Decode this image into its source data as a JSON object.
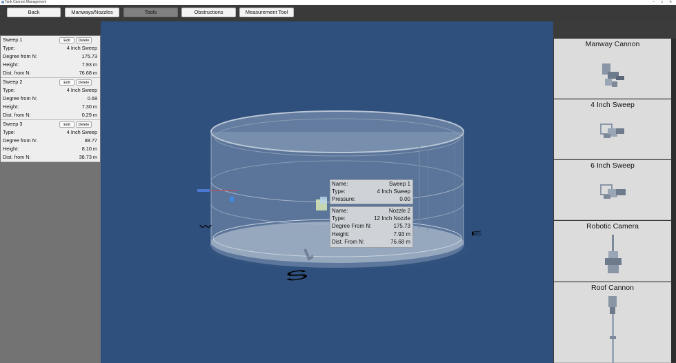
{
  "window": {
    "title": "Tank Cannon Management",
    "controls": [
      "–",
      "□",
      "✕"
    ]
  },
  "toolbar": {
    "buttons": [
      {
        "label": "Back",
        "active": false
      },
      {
        "label": "Manways/Nozzles",
        "active": false
      },
      {
        "label": "Tools",
        "active": true
      },
      {
        "label": "Obstructions",
        "active": false
      },
      {
        "label": "Measurement Tool",
        "active": false
      }
    ]
  },
  "left_panel": {
    "edit_label": "Edit",
    "delete_label": "Delete",
    "sweeps": [
      {
        "name": "Sweep 1",
        "rows": [
          {
            "label": "Type:",
            "value": "4 Inch Sweep"
          },
          {
            "label": "Degree from N:",
            "value": "175.73"
          },
          {
            "label": "Height:",
            "value": "7.93 m"
          },
          {
            "label": "Dist. from N:",
            "value": "76.68 m"
          }
        ]
      },
      {
        "name": "Sweep 2",
        "rows": [
          {
            "label": "Type:",
            "value": "4 Inch Sweep"
          },
          {
            "label": "Degree from N:",
            "value": "0.68"
          },
          {
            "label": "Height:",
            "value": "7.30 m"
          },
          {
            "label": "Dist. from N:",
            "value": "0.29 m"
          }
        ]
      },
      {
        "name": "Sweep 3",
        "rows": [
          {
            "label": "Type:",
            "value": "4 Inch Sweep"
          },
          {
            "label": "Degree from N:",
            "value": "88.77"
          },
          {
            "label": "Height:",
            "value": "8.10 m"
          },
          {
            "label": "Dist. from N:",
            "value": "38.73 m"
          }
        ]
      }
    ]
  },
  "viewport": {
    "compass": {
      "south": "S",
      "east": "E",
      "west": "W"
    },
    "sweep_info": [
      {
        "label": "Name:",
        "value": "Sweep 1"
      },
      {
        "label": "Type:",
        "value": "4 Inch Sweep"
      },
      {
        "label": "Pressure:",
        "value": "0.00"
      }
    ],
    "nozzle_info": [
      {
        "label": "Name:",
        "value": "Nozzle 2"
      },
      {
        "label": "Type:",
        "value": "12 Inch Nozzle"
      },
      {
        "label": "Degree From N:",
        "value": "175.73"
      },
      {
        "label": "Height:",
        "value": "7.93 m"
      },
      {
        "label": "Dist. From N:",
        "value": "76.68 m"
      }
    ]
  },
  "tools": [
    {
      "label": "Manway Cannon",
      "icon": "manway-cannon-icon"
    },
    {
      "label": "4 Inch Sweep",
      "icon": "four-inch-sweep-icon"
    },
    {
      "label": "6 Inch Sweep",
      "icon": "six-inch-sweep-icon"
    },
    {
      "label": "Robotic Camera",
      "icon": "robotic-camera-icon"
    },
    {
      "label": "Roof Cannon",
      "icon": "roof-cannon-icon"
    }
  ],
  "colors": {
    "viewport_bg": "#2f4f7c",
    "panel_bg": "#3b3b3b",
    "active_button": "#808080"
  }
}
